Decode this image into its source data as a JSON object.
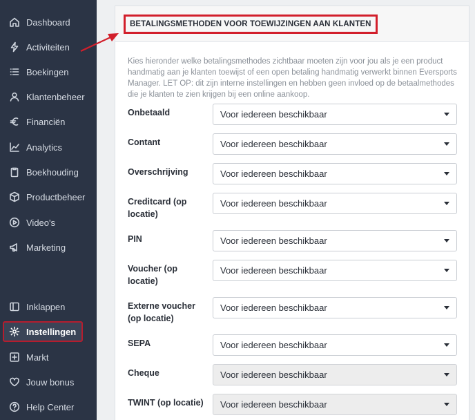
{
  "sidebar": {
    "items": [
      {
        "label": "Dashboard",
        "icon": "home-icon"
      },
      {
        "label": "Activiteiten",
        "icon": "bolt-icon"
      },
      {
        "label": "Boekingen",
        "icon": "list-icon"
      },
      {
        "label": "Klantenbeheer",
        "icon": "user-icon"
      },
      {
        "label": "Financiën",
        "icon": "euro-icon"
      },
      {
        "label": "Analytics",
        "icon": "chart-icon"
      },
      {
        "label": "Boekhouding",
        "icon": "clipboard-icon"
      },
      {
        "label": "Productbeheer",
        "icon": "box-icon"
      },
      {
        "label": "Video's",
        "icon": "play-icon"
      },
      {
        "label": "Marketing",
        "icon": "megaphone-icon"
      },
      {
        "label": "Inklappen",
        "icon": "collapse-icon"
      },
      {
        "label": "Instellingen",
        "icon": "gear-icon"
      },
      {
        "label": "Markt",
        "icon": "plus-square-icon"
      },
      {
        "label": "Jouw bonus",
        "icon": "heart-icon"
      },
      {
        "label": "Help Center",
        "icon": "help-icon"
      }
    ],
    "active_item": "Instellingen"
  },
  "card": {
    "title": "BETALINGSMETHODEN VOOR TOEWIJZINGEN AAN KLANTEN",
    "description": "Kies hieronder welke betalingsmethodes zichtbaar moeten zijn voor jou als je een product handmatig aan je klanten toewijst of een open betaling handmatig verwerkt binnen Eversports Manager. LET OP: dit zijn interne instellingen en hebben geen invloed op de betaalmethodes die je klanten te zien krijgen bij een online aankoop."
  },
  "payment_methods": [
    {
      "label": "Onbetaald",
      "value": "Voor iedereen beschikbaar",
      "disabled": false
    },
    {
      "label": "Contant",
      "value": "Voor iedereen beschikbaar",
      "disabled": false
    },
    {
      "label": "Overschrijving",
      "value": "Voor iedereen beschikbaar",
      "disabled": false
    },
    {
      "label": "Creditcard (op locatie)",
      "value": "Voor iedereen beschikbaar",
      "disabled": false
    },
    {
      "label": "PIN",
      "value": "Voor iedereen beschikbaar",
      "disabled": false
    },
    {
      "label": "Voucher (op locatie)",
      "value": "Voor iedereen beschikbaar",
      "disabled": false
    },
    {
      "label": "Externe voucher (op locatie)",
      "value": "Voor iedereen beschikbaar",
      "disabled": false
    },
    {
      "label": "SEPA",
      "value": "Voor iedereen beschikbaar",
      "disabled": false
    },
    {
      "label": "Cheque",
      "value": "Voor iedereen beschikbaar",
      "disabled": true
    },
    {
      "label": "TWINT (op locatie)",
      "value": "Voor iedereen beschikbaar",
      "disabled": true
    }
  ],
  "colors": {
    "sidebar_bg": "#2b3445",
    "highlight_red": "#d21f2b",
    "text_dark": "#2a2f38",
    "text_muted": "#8a9098"
  }
}
